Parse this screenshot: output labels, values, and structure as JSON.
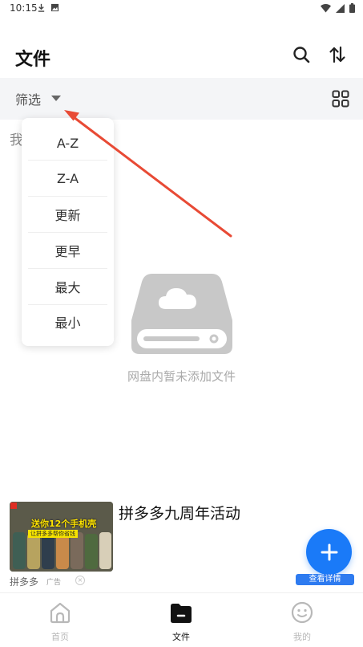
{
  "status_bar": {
    "time": "10:15"
  },
  "header": {
    "title": "文件"
  },
  "filter_bar": {
    "label": "筛选"
  },
  "partial_text": "我",
  "sort_menu": {
    "items": [
      "A-Z",
      "Z-A",
      "更新",
      "更早",
      "最大",
      "最小"
    ]
  },
  "empty_state": {
    "message": "网盘内暂未添加文件"
  },
  "ad": {
    "title": "拼多多九周年活动",
    "image_caption_top": "送你12个手机壳",
    "image_caption_bottom": "让拼多多帮你省钱",
    "source": "拼多多",
    "ad_tag": "广告",
    "detail_button": "查看详情"
  },
  "bottom_nav": {
    "items": [
      {
        "label": "首页",
        "active": false
      },
      {
        "label": "文件",
        "active": true
      },
      {
        "label": "我的",
        "active": false
      }
    ]
  },
  "colors": {
    "accent": "#1a7af8",
    "annotation_arrow": "#e84a35",
    "inactive": "#b8b8b8"
  }
}
